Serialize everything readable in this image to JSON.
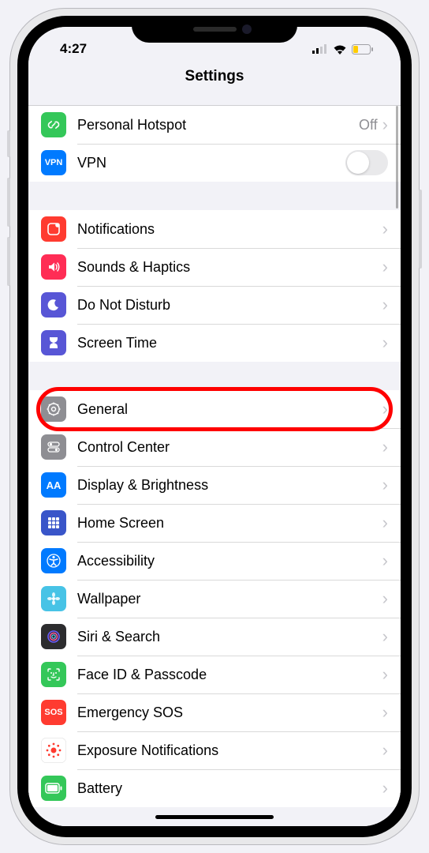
{
  "status": {
    "time": "4:27"
  },
  "header": {
    "title": "Settings"
  },
  "groups": [
    {
      "rows": [
        {
          "id": "personal-hotspot",
          "label": "Personal Hotspot",
          "value": "Off",
          "accessory": "disclosure"
        },
        {
          "id": "vpn",
          "label": "VPN",
          "iconText": "VPN",
          "accessory": "toggle",
          "toggleOn": false
        }
      ]
    },
    {
      "rows": [
        {
          "id": "notifications",
          "label": "Notifications",
          "accessory": "disclosure"
        },
        {
          "id": "sounds-haptics",
          "label": "Sounds & Haptics",
          "accessory": "disclosure"
        },
        {
          "id": "do-not-disturb",
          "label": "Do Not Disturb",
          "accessory": "disclosure"
        },
        {
          "id": "screen-time",
          "label": "Screen Time",
          "accessory": "disclosure"
        }
      ]
    },
    {
      "rows": [
        {
          "id": "general",
          "label": "General",
          "accessory": "disclosure",
          "highlighted": true
        },
        {
          "id": "control-center",
          "label": "Control Center",
          "accessory": "disclosure"
        },
        {
          "id": "display-brightness",
          "label": "Display & Brightness",
          "iconText": "AA",
          "accessory": "disclosure"
        },
        {
          "id": "home-screen",
          "label": "Home Screen",
          "accessory": "disclosure"
        },
        {
          "id": "accessibility",
          "label": "Accessibility",
          "accessory": "disclosure"
        },
        {
          "id": "wallpaper",
          "label": "Wallpaper",
          "accessory": "disclosure"
        },
        {
          "id": "siri-search",
          "label": "Siri & Search",
          "accessory": "disclosure"
        },
        {
          "id": "face-id-passcode",
          "label": "Face ID & Passcode",
          "accessory": "disclosure"
        },
        {
          "id": "emergency-sos",
          "label": "Emergency SOS",
          "iconText": "SOS",
          "accessory": "disclosure"
        },
        {
          "id": "exposure-notifications",
          "label": "Exposure Notifications",
          "accessory": "disclosure"
        },
        {
          "id": "battery",
          "label": "Battery",
          "accessory": "disclosure"
        }
      ]
    }
  ]
}
